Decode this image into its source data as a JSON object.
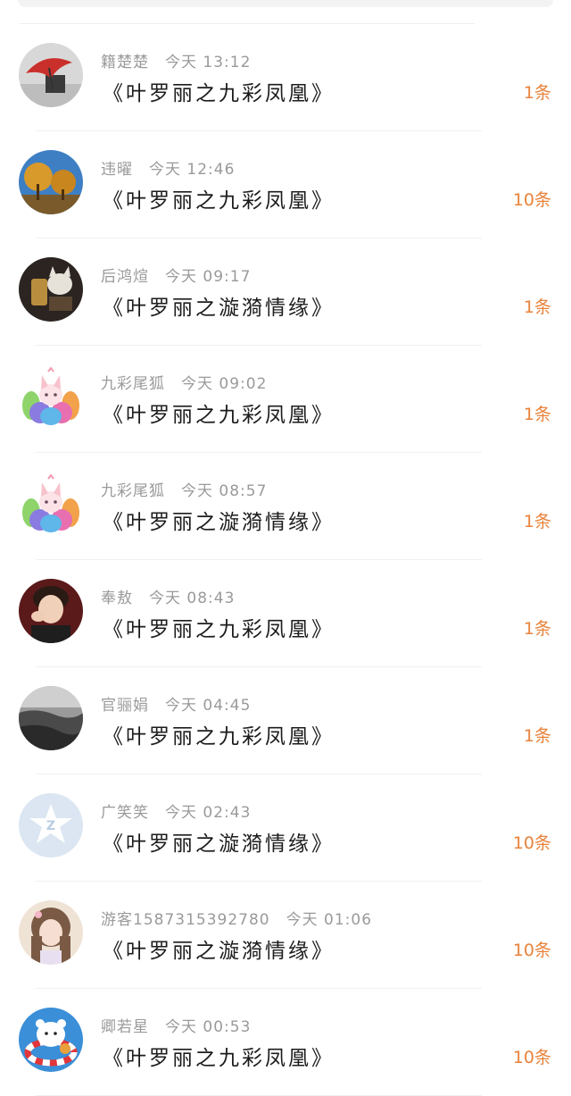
{
  "items": [
    {
      "name": "籍楚楚",
      "time": "今天 13:12",
      "title": "《叶罗丽之九彩凤凰》",
      "count": "1条",
      "avatar": "umbrella-avatar"
    },
    {
      "name": "违曜",
      "time": "今天 12:46",
      "title": "《叶罗丽之九彩凤凰》",
      "count": "10条",
      "avatar": "autumn-tree-avatar"
    },
    {
      "name": "后鸿煊",
      "time": "今天 09:17",
      "title": "《叶罗丽之漩漪情缘》",
      "count": "1条",
      "avatar": "cat-avatar"
    },
    {
      "name": "九彩尾狐",
      "time": "今天 09:02",
      "title": "《叶罗丽之九彩凤凰》",
      "count": "1条",
      "avatar": "fox-avatar"
    },
    {
      "name": "九彩尾狐",
      "time": "今天 08:57",
      "title": "《叶罗丽之漩漪情缘》",
      "count": "1条",
      "avatar": "fox-avatar"
    },
    {
      "name": "奉敖",
      "time": "今天 08:43",
      "title": "《叶罗丽之九彩凤凰》",
      "count": "1条",
      "avatar": "boy-avatar"
    },
    {
      "name": "官骊娟",
      "time": "今天 04:45",
      "title": "《叶罗丽之九彩凤凰》",
      "count": "1条",
      "avatar": "landscape-avatar"
    },
    {
      "name": "广笑笑",
      "time": "今天 02:43",
      "title": "《叶罗丽之漩漪情缘》",
      "count": "10条",
      "avatar": "default-avatar"
    },
    {
      "name": "游客1587315392780",
      "time": "今天 01:06",
      "title": "《叶罗丽之漩漪情缘》",
      "count": "10条",
      "avatar": "girl-avatar"
    },
    {
      "name": "卿若星",
      "time": "今天 00:53",
      "title": "《叶罗丽之九彩凤凰》",
      "count": "10条",
      "avatar": "cartoon-bear-avatar"
    }
  ]
}
